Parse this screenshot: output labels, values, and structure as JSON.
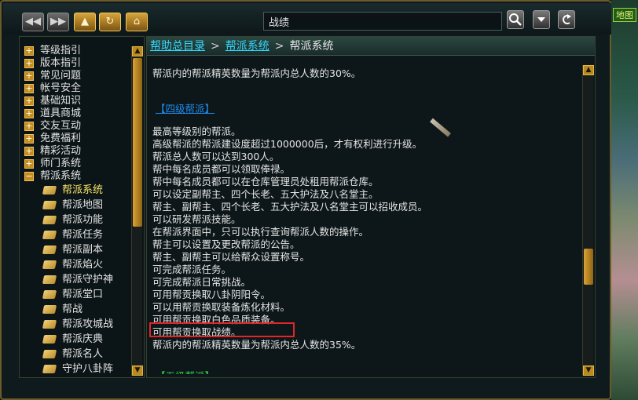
{
  "toolbar": {
    "back_label": "◀◀",
    "forward_label": "▶▶",
    "up_label": "▲",
    "refresh_label": "↻",
    "home_label": "⌂",
    "search_value": "战绩",
    "search_icon": "magnifier-icon",
    "dropdown_icon": "chevron-down-icon",
    "return_icon": "return-icon"
  },
  "sidebar": {
    "categories": [
      {
        "label": "等级指引",
        "expanded": false
      },
      {
        "label": "版本指引",
        "expanded": false
      },
      {
        "label": "常见问题",
        "expanded": false
      },
      {
        "label": "帐号安全",
        "expanded": false
      },
      {
        "label": "基础知识",
        "expanded": false
      },
      {
        "label": "道具商城",
        "expanded": false
      },
      {
        "label": "交友互动",
        "expanded": false
      },
      {
        "label": "免费福利",
        "expanded": false
      },
      {
        "label": "精彩活动",
        "expanded": false
      },
      {
        "label": "师门系统",
        "expanded": false
      },
      {
        "label": "帮派系统",
        "expanded": true
      }
    ],
    "expand_glyph": "+",
    "collapse_glyph": "−",
    "subitems": [
      {
        "label": "帮派系统",
        "selected": true
      },
      {
        "label": "帮派地图",
        "selected": false
      },
      {
        "label": "帮派功能",
        "selected": false
      },
      {
        "label": "帮派任务",
        "selected": false
      },
      {
        "label": "帮派副本",
        "selected": false
      },
      {
        "label": "帮派焰火",
        "selected": false
      },
      {
        "label": "帮派守护神",
        "selected": false
      },
      {
        "label": "帮派堂口",
        "selected": false
      },
      {
        "label": "帮战",
        "selected": false
      },
      {
        "label": "帮派攻城战",
        "selected": false
      },
      {
        "label": "帮派庆典",
        "selected": false
      },
      {
        "label": "帮派名人",
        "selected": false
      },
      {
        "label": "守护八卦阵",
        "selected": false
      }
    ]
  },
  "breadcrumb": {
    "root": "帮助总目录",
    "parent": "帮派系统",
    "current": "帮派系统",
    "separator": ">"
  },
  "content": {
    "intro": "帮派内的帮派精英数量为帮派内总人数的30%。",
    "section_heading": "【四级帮派】",
    "lines": [
      "最高等级别的帮派。",
      "高级帮派的帮派建设度超过1000000后，才有权利进行升级。",
      "帮派总人数可以达到300人。",
      "帮中每名成员都可以领取俸禄。",
      "帮中每名成员都可以在仓库管理员处租用帮派仓库。",
      "可以设定副帮主、四个长老、五大护法及八名堂主。",
      "帮主、副帮主、四个长老、五大护法及八名堂主可以招收成员。",
      "可以研发帮派技能。",
      "在帮派界面中，只可以执行查询帮派人数的操作。",
      "帮主可以设置及更改帮派的公告。",
      "帮主、副帮主可以给帮众设置称号。",
      "可完成帮派任务。",
      "可完成帮派日常挑战。",
      "可用帮贡换取八卦阴阳令。",
      "可以用帮贡换取装备炼化材料。",
      "可用帮贡换取白色品质装备。",
      "可用帮贡换取战绩。",
      "帮派内的帮派精英数量为帮派内总人数的35%。"
    ],
    "next_section_heading": "【五级帮派】"
  },
  "right_strip_tag": "地图",
  "colors": {
    "link": "#32d9ff",
    "section": "#1e8cf0",
    "highlight_border": "#e0262a",
    "selected_item": "#f7e56a",
    "gold": "#c68d1e"
  }
}
